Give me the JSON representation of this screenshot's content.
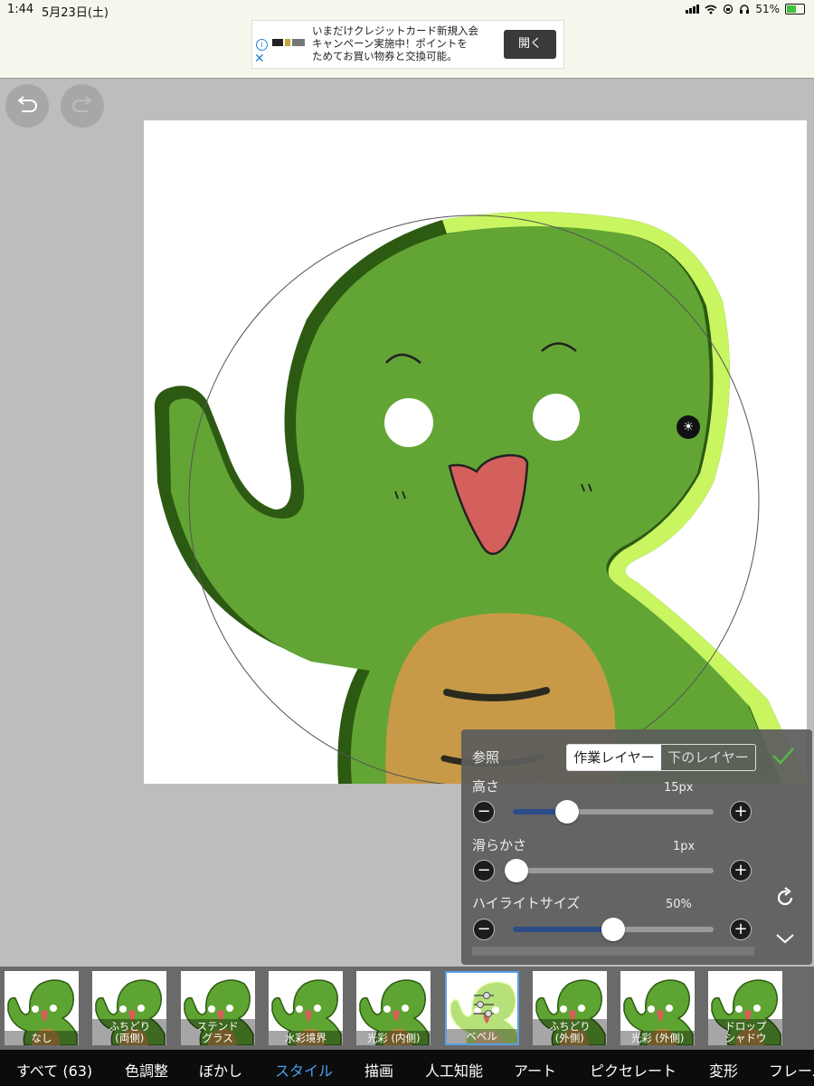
{
  "status": {
    "time": "1:44",
    "date": "5月23日(土)",
    "battery": "51%"
  },
  "ad": {
    "text": "いまだけクレジットカード新規入会\nキャンペーン実施中！ポイントを\nためてお買い物券と交換可能。",
    "button": "開く",
    "close": "✕",
    "info": "i"
  },
  "icons": {
    "undo": "undo-icon",
    "redo": "redo-icon",
    "light": "sun-icon",
    "confirm": "check-icon",
    "reset": "refresh-icon",
    "collapse": "chevron-down-icon"
  },
  "panel": {
    "reference_label": "参照",
    "reference_options": [
      "作業レイヤー",
      "下のレイヤー"
    ],
    "height": {
      "label": "高さ",
      "value": "15px",
      "level": 0.27
    },
    "smoothness": {
      "label": "滑らかさ",
      "value": "1px",
      "level": 0.02
    },
    "highlight": {
      "label": "ハイライトサイズ",
      "value": "50%",
      "level": 0.5
    },
    "minus": "−",
    "plus": "+"
  },
  "thumbnails": [
    {
      "label": "なし"
    },
    {
      "label": "ふちどり\n(両側)"
    },
    {
      "label": "ステンド\nグラス"
    },
    {
      "label": "水彩境界"
    },
    {
      "label": "光彩 (内側)"
    },
    {
      "label": "ベベル",
      "selected": true
    },
    {
      "label": "ふちどり\n(外側)"
    },
    {
      "label": "光彩 (外側)"
    },
    {
      "label": "ドロップ\nシャドウ"
    }
  ],
  "nav": [
    "すべて (63)",
    "色調整",
    "ぼかし",
    "スタイル",
    "描画",
    "人工知能",
    "アート",
    "ピクセレート",
    "変形",
    "フレーム"
  ],
  "nav_active": "スタイル",
  "colors": {
    "character": "#62a535",
    "bevel_light": "#c8f560",
    "bevel_dark": "#2d5a12",
    "belly": "#c89a48",
    "mouth": "#d4605c",
    "accent": "#4a9ef0",
    "slider_fill": "#2c4d88"
  }
}
